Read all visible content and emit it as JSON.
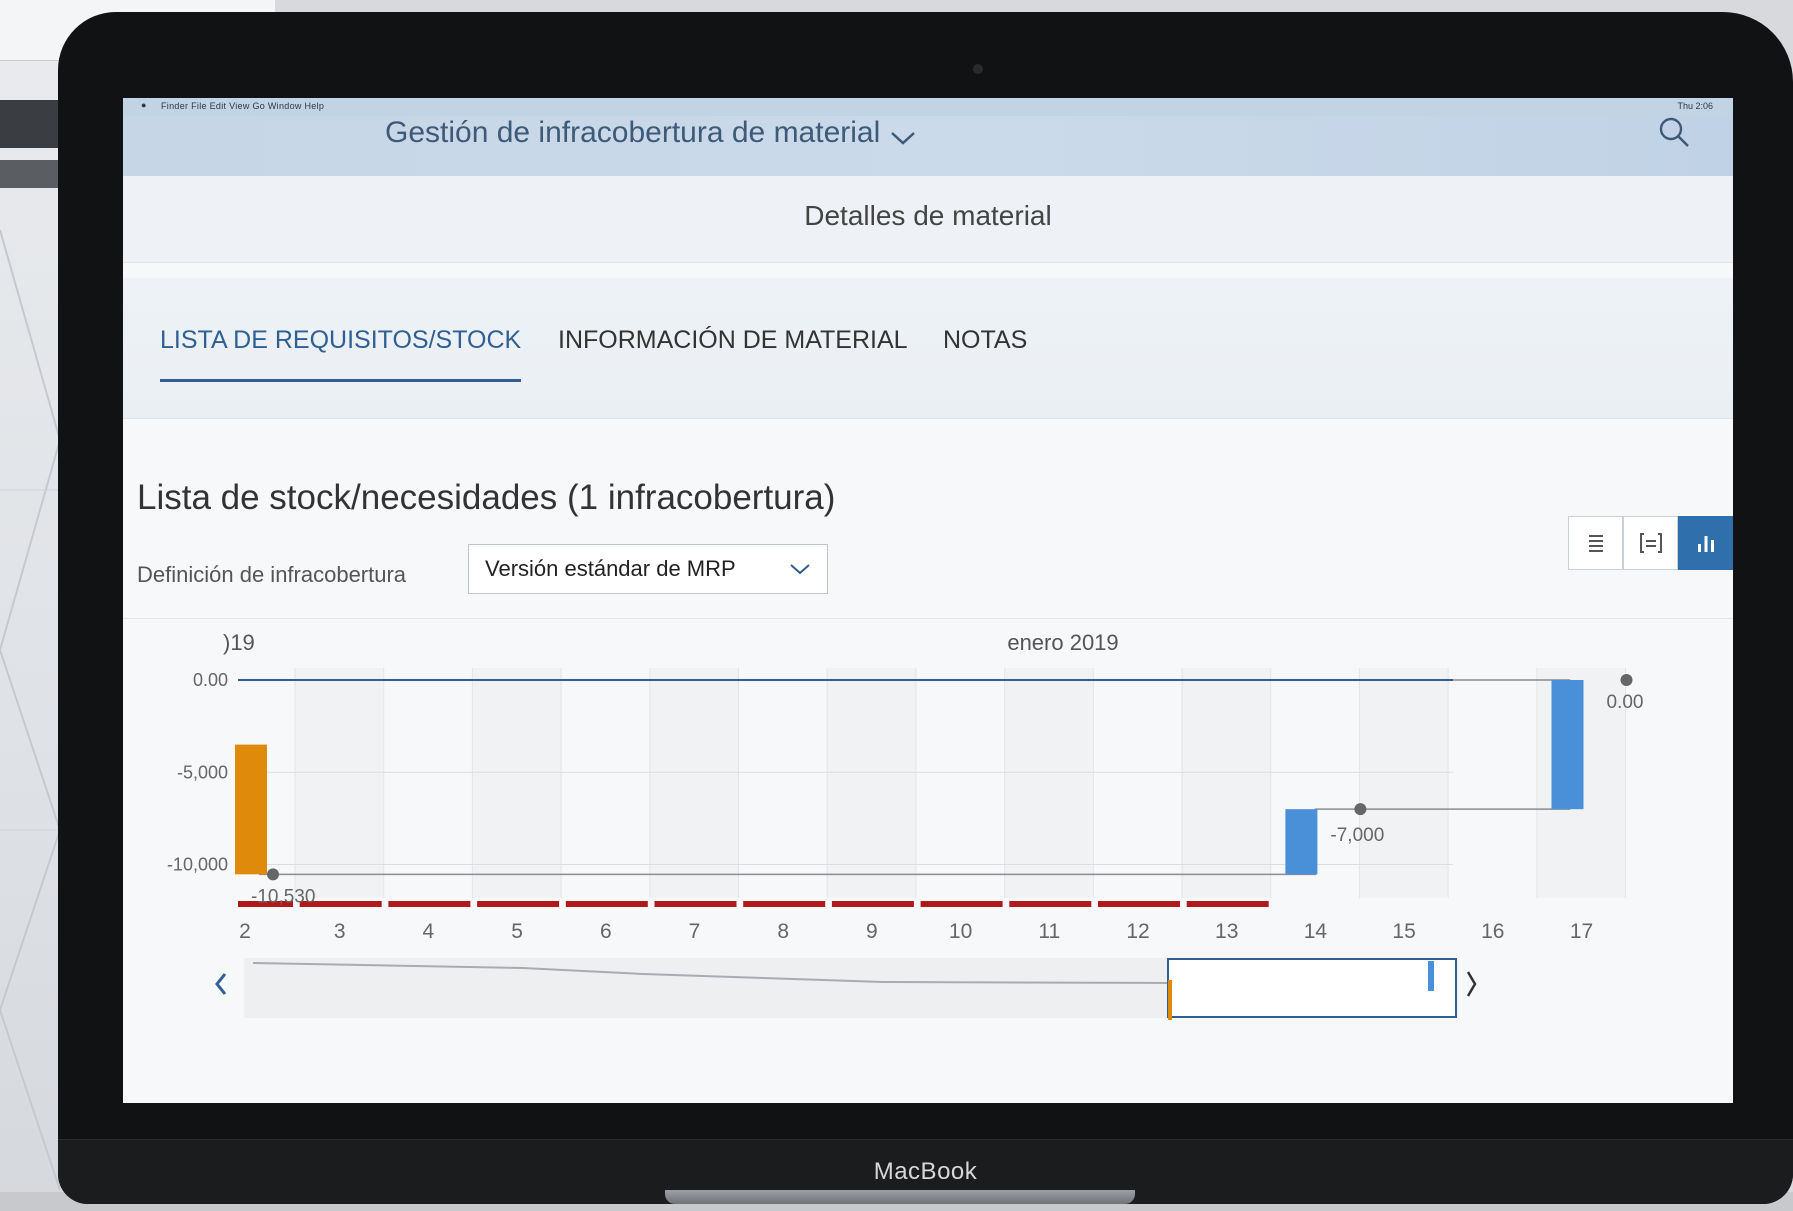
{
  "menubar": {
    "items": "Finder   File   Edit   View   Go   Window   Help",
    "right": "Thu 2:06"
  },
  "shell": {
    "title": "Gestión de infracobertura de material"
  },
  "page": {
    "subtitle": "Detalles de material"
  },
  "tabs": [
    {
      "label": "LISTA DE REQUISITOS/STOCK",
      "active": true
    },
    {
      "label": "INFORMACIÓN DE MATERIAL",
      "active": false
    },
    {
      "label": "NOTAS",
      "active": false
    }
  ],
  "section": {
    "title": "Lista de stock/necesidades (1 infracobertura)",
    "definition_label": "Definición de infracobertura",
    "definition_value": "Versión estándar de MRP"
  },
  "view_switch": [
    "list-view",
    "detail-view",
    "chart-view"
  ],
  "device": {
    "brand": "MacBook"
  },
  "chart_data": {
    "type": "bar",
    "month_labels": [
      ")19",
      "enero 2019"
    ],
    "ylim": [
      -11000,
      0
    ],
    "yticks": [
      "0.00",
      "-5,000",
      "-10,000"
    ],
    "x_ticks": [
      "2",
      "3",
      "4",
      "5",
      "6",
      "7",
      "8",
      "9",
      "10",
      "11",
      "12",
      "13",
      "14",
      "15",
      "16",
      "17"
    ],
    "bars": [
      {
        "day": 2,
        "from": -3500,
        "to": -10530,
        "color": "#e08a0b"
      },
      {
        "day": 14,
        "from": -10530,
        "to": -7000,
        "color": "#4a90d9"
      },
      {
        "day": 17,
        "from": -7000,
        "to": 0,
        "color": "#4a90d9"
      }
    ],
    "points": [
      {
        "day": 2.5,
        "value": -10530,
        "label": "-10,530"
      },
      {
        "day": 14.5,
        "value": -7000,
        "label": "-7,000"
      },
      {
        "day": 17.5,
        "value": 0,
        "label": "0.00"
      }
    ],
    "shortage_from_day": 2,
    "shortage_to_day": 13,
    "colors": {
      "shortage": "#b11a1a",
      "receipt": "#4a90d9",
      "requirement": "#e08a0b",
      "zero_line": "#2f5f93"
    }
  }
}
